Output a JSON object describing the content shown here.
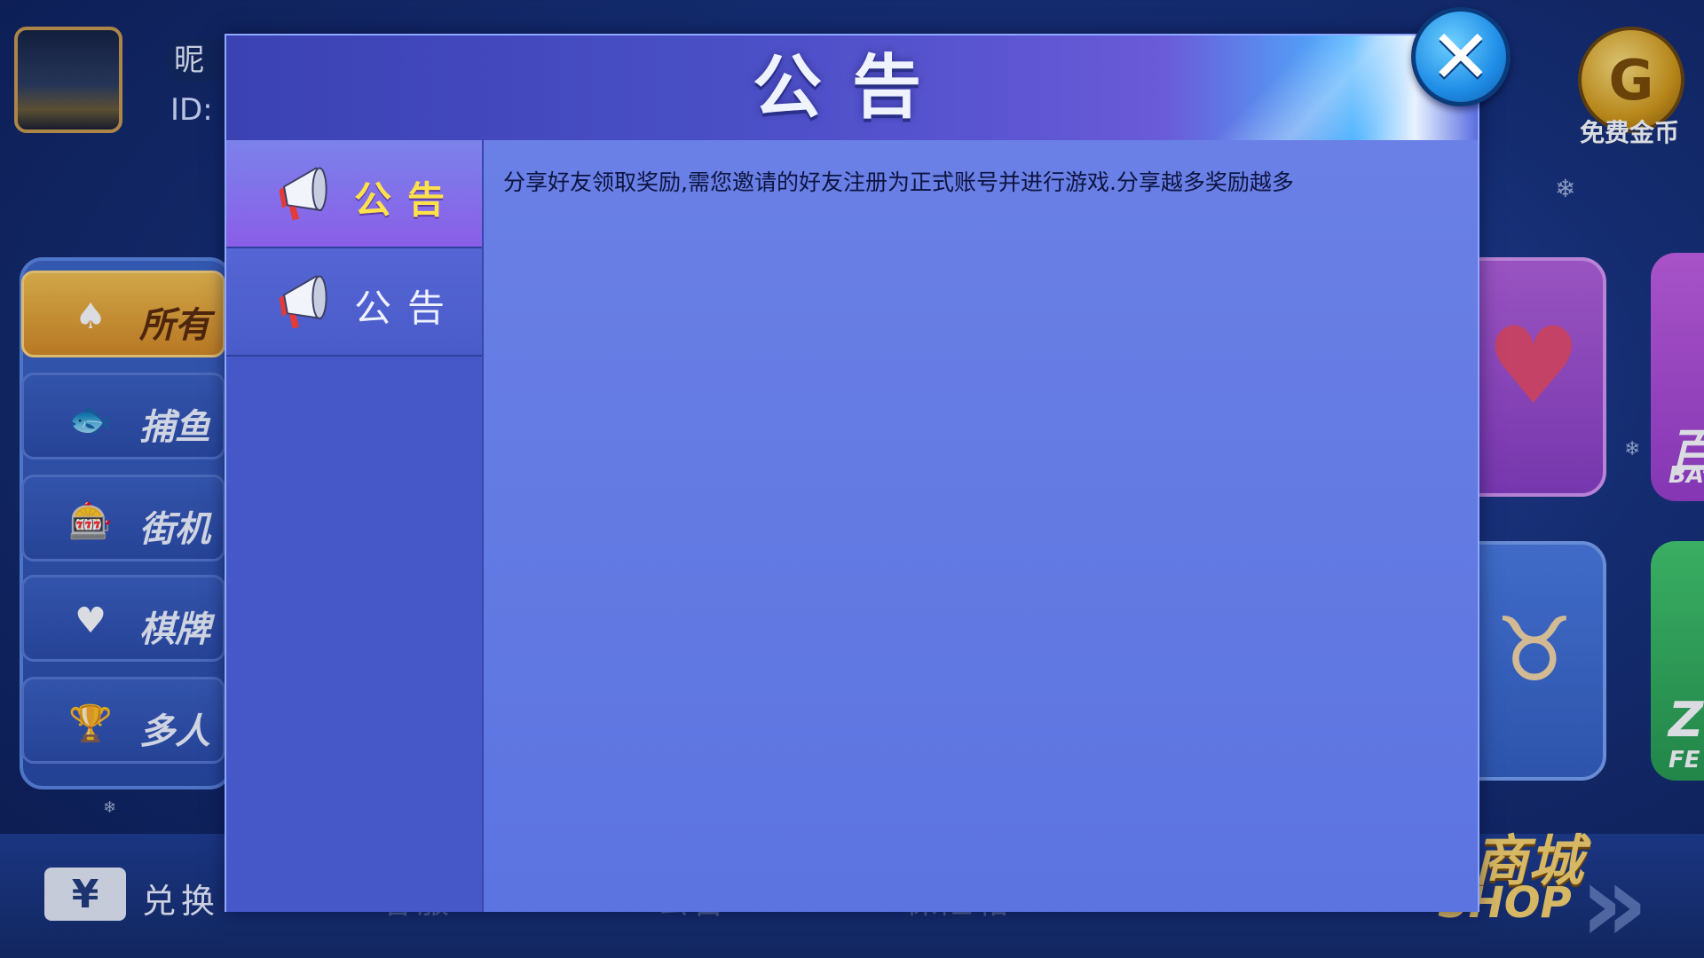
{
  "lobby": {
    "nickname_char": "昵",
    "id_label": "ID:",
    "categories": [
      {
        "label": "所有",
        "icon": "♠"
      },
      {
        "label": "捕鱼",
        "icon": "🐟"
      },
      {
        "label": "街机",
        "icon": "🎰"
      },
      {
        "label": "棋牌",
        "icon": "♥"
      },
      {
        "label": "多人",
        "icon": "🏆"
      }
    ],
    "exchange_icon": "¥",
    "exchange_label": "兑换",
    "bottom_items": [
      "客服",
      "公告",
      "保险箱"
    ],
    "free_coin_icon": "G",
    "free_coin_label": "免费金币",
    "shop_label": "商城",
    "shop_en": "SHOP",
    "side_card_texts": [
      "百",
      "BA",
      "Z",
      "FE"
    ]
  },
  "modal": {
    "title": "公告",
    "close_icon": "close-icon",
    "tabs": [
      {
        "label": "公告",
        "active": true
      },
      {
        "label": "公告",
        "active": false
      }
    ],
    "content_text": "分享好友领取奖励,需您邀请的好友注册为正式账号并进行游戏.分享越多奖励越多"
  },
  "colors": {
    "active_tab_text": "#ffe14a",
    "modal_body": "#5c74e0",
    "close_button": "#1f8de6"
  }
}
